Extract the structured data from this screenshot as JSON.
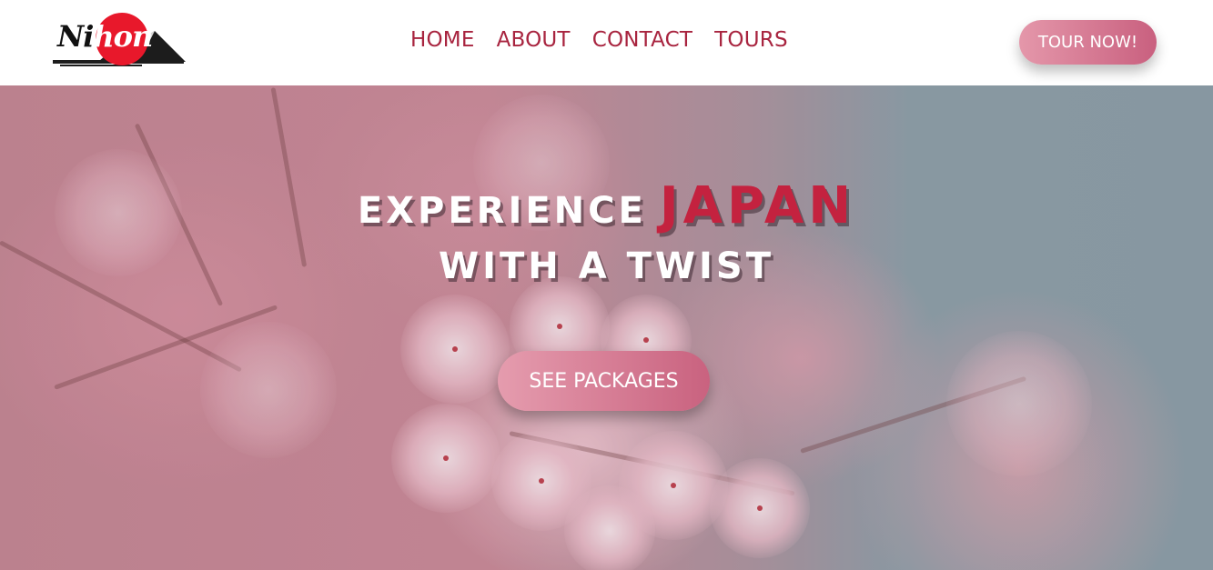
{
  "header": {
    "logo_text_part1": "Ni",
    "logo_text_part2": "hon",
    "nav": [
      {
        "label": "HOME"
      },
      {
        "label": "ABOUT"
      },
      {
        "label": "CONTACT"
      },
      {
        "label": "TOURS"
      }
    ],
    "cta_label": "TOUR NOW!"
  },
  "hero": {
    "title_part1": "EXPERIENCE",
    "title_highlight": "JAPAN",
    "title_line2": "WITH A TWIST",
    "button_label": "SEE PACKAGES"
  },
  "colors": {
    "accent": "#a8243f",
    "highlight": "#c4223f",
    "button_gradient_start": "#e497aa",
    "button_gradient_end": "#c9607f",
    "logo_sun": "#e8182b"
  }
}
